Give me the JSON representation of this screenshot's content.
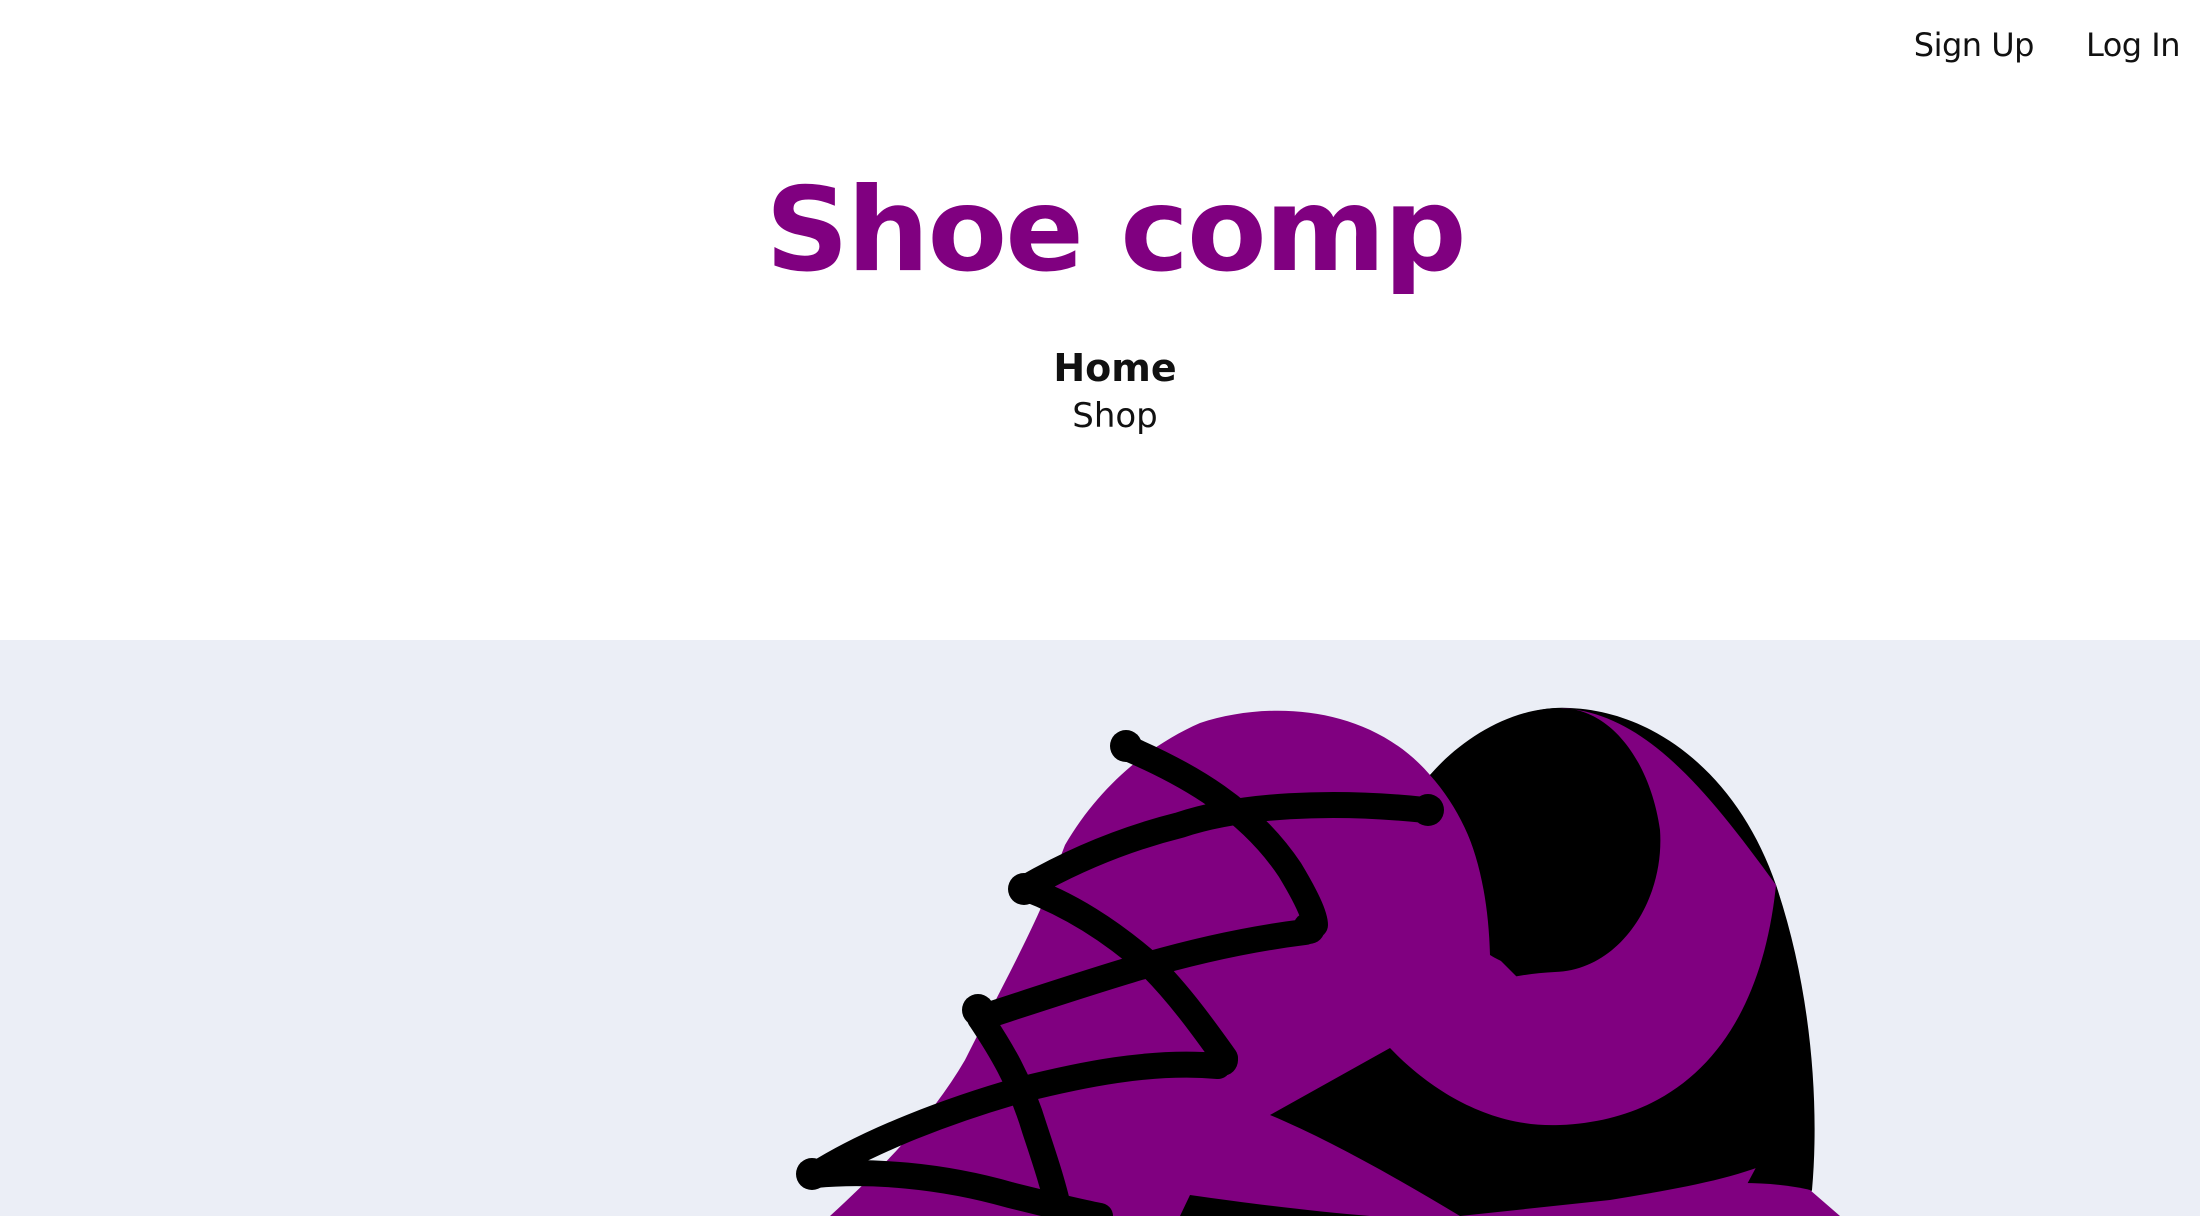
{
  "header": {
    "auth": {
      "signup_label": "Sign Up",
      "login_label": "Log In"
    },
    "site_title": "Shoe comp",
    "nav": {
      "home_label": "Home",
      "shop_label": "Shop"
    }
  },
  "hero": {
    "image": "purple-sneaker-illustration"
  },
  "colors": {
    "brand": "#800080",
    "hero_background": "#ebeef6",
    "text": "#111111",
    "lace": "#000000"
  }
}
